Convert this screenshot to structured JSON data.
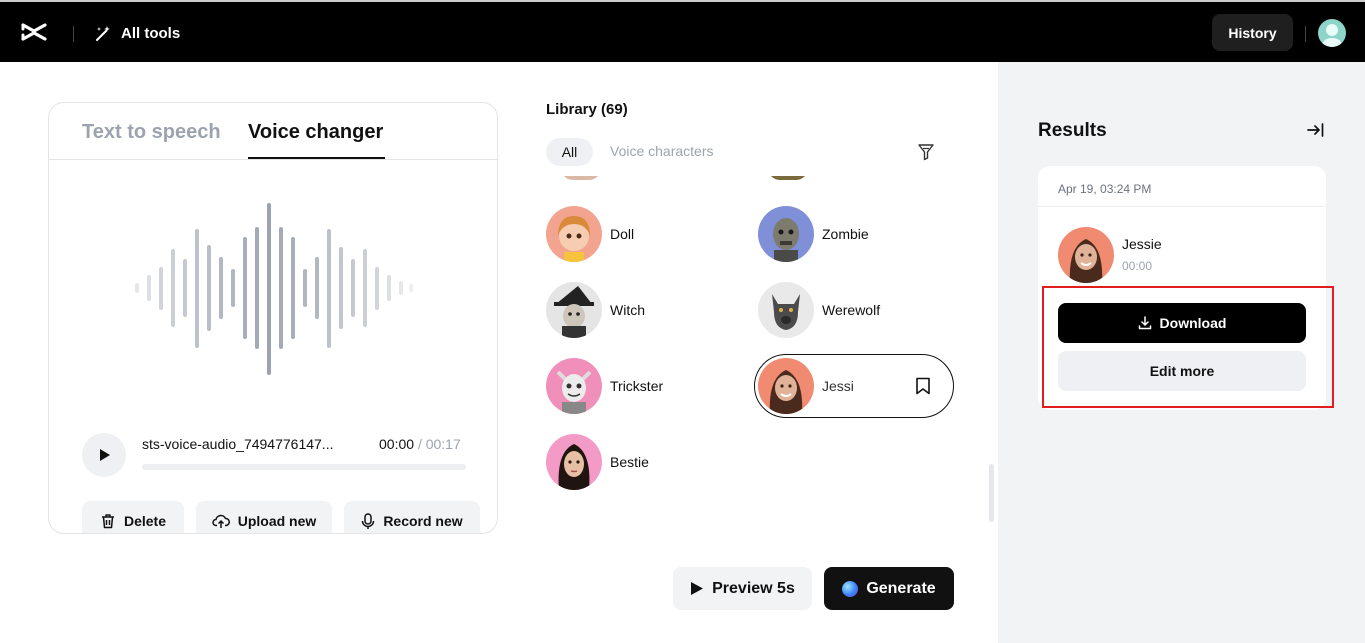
{
  "topbar": {
    "all_tools_label": "All tools",
    "history_label": "History"
  },
  "editor": {
    "tabs": [
      {
        "label": "Text to speech",
        "active": false
      },
      {
        "label": "Voice changer",
        "active": true
      }
    ],
    "audio": {
      "filename": "sts-voice-audio_7494776147...",
      "current_time": "00:00",
      "separator": "/",
      "duration": "00:17",
      "progress": 0
    },
    "actions": {
      "delete_label": "Delete",
      "upload_label": "Upload new",
      "record_label": "Record new"
    }
  },
  "library": {
    "title": "Library (69)",
    "filters": {
      "all_label": "All",
      "characters_label": "Voice characters",
      "active": "All"
    },
    "voices": [
      {
        "name": "Doll"
      },
      {
        "name": "Zombie"
      },
      {
        "name": "Witch"
      },
      {
        "name": "Werewolf"
      },
      {
        "name": "Trickster"
      },
      {
        "name": "Jessi",
        "selected": true
      },
      {
        "name": "Bestie"
      }
    ]
  },
  "footer": {
    "preview_label": "Preview 5s",
    "generate_label": "Generate"
  },
  "results": {
    "title": "Results",
    "item": {
      "date": "Apr 19, 03:24 PM",
      "voice_name": "Jessie",
      "time": "00:00",
      "download_label": "Download",
      "edit_label": "Edit more"
    }
  },
  "colors": {
    "highlight": "#e11d1d",
    "primary": "#000000",
    "panel_bg": "#f2f3f5"
  }
}
